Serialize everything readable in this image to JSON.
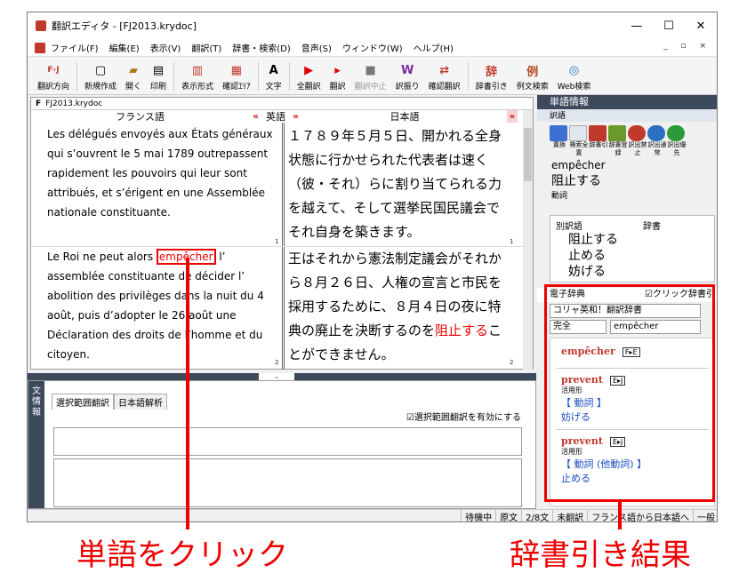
{
  "window": {
    "title": "翻訳エディタ - [FJ2013.krydoc]",
    "controls": [
      "—",
      "☐",
      "✕"
    ]
  },
  "menu": [
    "ファイル(F)",
    "編集(E)",
    "表示(V)",
    "翻訳(T)",
    "辞書・検索(D)",
    "音声(S)",
    "ウィンドウ(W)",
    "ヘルプ(H)"
  ],
  "mdi_controls": "_ ▫ ×",
  "toolbar": [
    {
      "label": "翻訳方向",
      "icon": "F›J"
    },
    {
      "label": "新規作成",
      "icon": "▢"
    },
    {
      "label": "開く",
      "icon": "▰"
    },
    {
      "label": "印刷",
      "icon": "▤"
    },
    {
      "label": "表示形式",
      "icon": "▥"
    },
    {
      "label": "確認ｴﾘｱ",
      "icon": "▦"
    },
    {
      "label": "文字",
      "icon": "A"
    },
    {
      "label": "全翻訳",
      "icon": "▶"
    },
    {
      "label": "翻訳",
      "icon": "▸"
    },
    {
      "label": "翻訳中止",
      "icon": "■"
    },
    {
      "label": "訳振り",
      "icon": "W"
    },
    {
      "label": "確認翻訳",
      "icon": "⇄"
    },
    {
      "label": "辞書引き",
      "icon": "辞"
    },
    {
      "label": "例文検索",
      "icon": "例"
    },
    {
      "label": "Web検索",
      "icon": "◎"
    }
  ],
  "doc": {
    "tab": "FJ2013.krydoc",
    "tab_prefix": "F",
    "col_fr": "フランス語",
    "col_en": "英語",
    "col_ja": "日本語",
    "arrow_left": "«",
    "arrow_right": "»",
    "p1_fr": "Les délégués envoyés aux États généraux qui s’ouvrent le 5 mai 1789 outrepassent rapidement les pouvoirs qui leur sont attribués, et s’érigent en une Assemblée nationale constituante.",
    "p1_ja": "１７８９年５月５日、開かれる全身状態に行かせられた代表者は速く（彼・それ）らに割り当てられる力を越えて、そして選挙民国民議会でそれ自身を築きます。",
    "p1_num": "1",
    "p2_fr_a": "Le Roi ne peut alors ",
    "p2_fr_word": "empêcher",
    "p2_fr_b": " l’ assemblée constituante de décider l’ abolition des privilèges dans la nuit du 4 août, puis d’adopter le 26 août une Déclaration des droits de l’homme et du citoyen.",
    "p2_ja_a": "王はそれから憲法制定議会がそれから８月２６日、人権の宣言と市民を採用するために、８月４日の夜に特典の廃止を決断するのを",
    "p2_ja_hl": "阻止する",
    "p2_ja_b": "ことができません。",
    "p2_num": "2"
  },
  "bottom": {
    "side_label": "文情報",
    "tabs": [
      "選択範囲翻訳",
      "日本語解析"
    ],
    "checkbox": "☑選択範囲翻訳を有効にする"
  },
  "status": [
    "待機中",
    "原文",
    "2/8文",
    "未翻訳",
    "フランス語から日本語へ",
    "一般"
  ],
  "right": {
    "title": "単語情報",
    "sub": "訳語",
    "icons": [
      {
        "label": "置換",
        "color": "#3c6fd1"
      },
      {
        "label": "検索全置",
        "color": "#dfe6ee"
      },
      {
        "label": "辞書引",
        "color": "#c0392b"
      },
      {
        "label": "辞書登録",
        "color": "#6c9a2a"
      },
      {
        "label": "訳出禁止",
        "color": "#c0392b"
      },
      {
        "label": "訳出通常",
        "color": "#2b6fc0"
      },
      {
        "label": "訳出優先",
        "color": "#2b9a3a"
      }
    ],
    "headword": "empêcher",
    "translation": "阻止する",
    "pos": "動詞",
    "alt_col1": "別訳語",
    "alt_col2": "辞書",
    "alternatives": [
      "阻止する",
      "止める",
      "妨げる"
    ],
    "ed_title": "電子辞典",
    "ed_checkbox": "☑クリック辞書引",
    "dict_select": "コリャ英和！翻訳辞書",
    "match_select": "完全",
    "search_value": "empêcher",
    "entries": [
      {
        "word": "empêcher",
        "badge": "F▸E",
        "tag": "",
        "meaning": "",
        "gloss": ""
      },
      {
        "word": "prevent",
        "badge": "E▸J",
        "tag": "活用形",
        "meaning": "【 動詞 】",
        "gloss": "妨げる"
      },
      {
        "word": "prevent",
        "badge": "E▸J",
        "tag": "活用形",
        "meaning": "【 動詞 (他動詞) 】",
        "gloss": "止める"
      }
    ]
  },
  "captions": {
    "left": "単語をクリック",
    "right": "辞書引き結果"
  }
}
